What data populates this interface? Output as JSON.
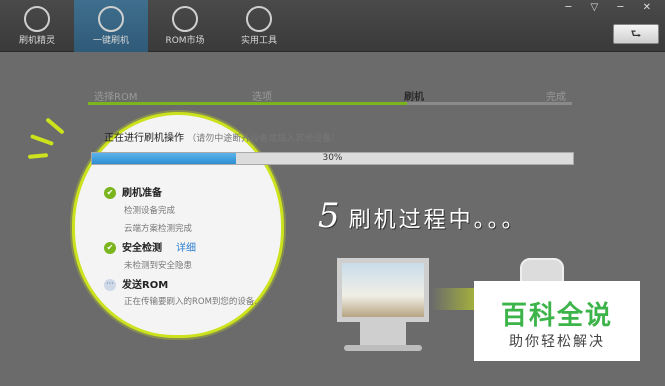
{
  "toolbar": {
    "items": [
      {
        "label": "刷机精灵",
        "icon": "s-logo-icon"
      },
      {
        "label": "一键刷机",
        "icon": "play-icon",
        "active": true
      },
      {
        "label": "ROM市场",
        "icon": "robot-icon"
      },
      {
        "label": "实用工具",
        "icon": "grid-icon"
      }
    ],
    "window_controls": "─ ▽ ─ ✕",
    "refresh_glyph": "⮑"
  },
  "steps": {
    "items": [
      "选择ROM",
      "选项",
      "刷机",
      "完成"
    ],
    "current_index": 2
  },
  "flash": {
    "title": "正在进行刷机操作",
    "tip": "（请勿中途断开设备或插入其他设备）",
    "progress_text": "30%",
    "progress": 0.3,
    "tasks": [
      {
        "name": "刷机准备",
        "status": "done",
        "subs": [
          "检测设备完成",
          "云端方案检测完成"
        ]
      },
      {
        "name": "安全检测",
        "status": "done",
        "link": "详细",
        "subs": [
          "未检测到安全隐患"
        ]
      },
      {
        "name": "发送ROM",
        "status": "pending",
        "subs": [
          "正在传输要刷入的ROM到您的设备..."
        ]
      }
    ]
  },
  "overlay": {
    "num": "5",
    "text": "刷机过程中。。。"
  },
  "watermark": {
    "title": "百科全说",
    "subtitle": "助你轻松解决"
  },
  "colors": {
    "accent_green": "#cbe21c",
    "progress_blue": "#2d8ed0",
    "check_green": "#7ab51d"
  }
}
